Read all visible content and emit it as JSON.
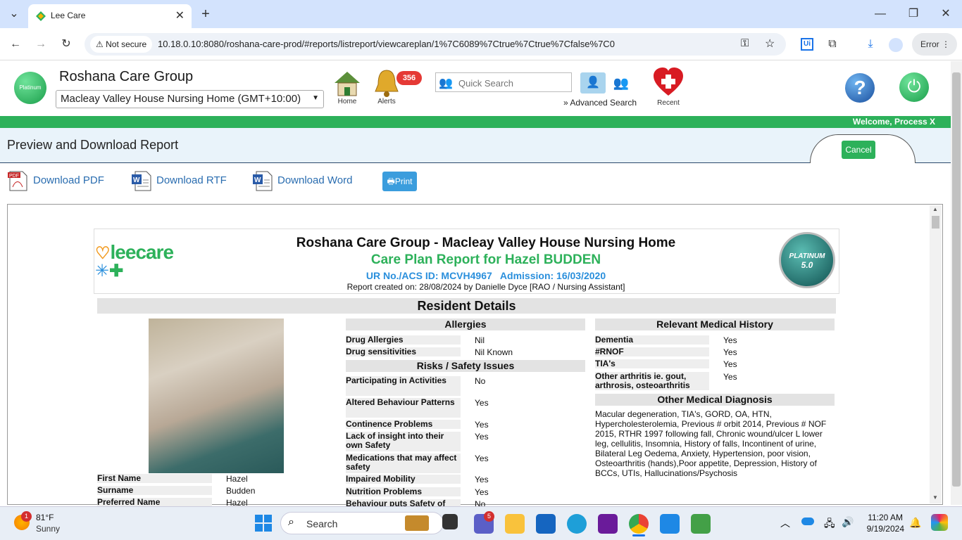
{
  "browser": {
    "tab_title": "Lee Care",
    "security_label": "Not secure",
    "url": "10.18.0.10:8080/roshana-care-prod/#reports/listreport/viewcareplan/1%7C6089%7Ctrue%7Ctrue%7Cfalse%7C0",
    "profile_label": "Error"
  },
  "app": {
    "org_name": "Roshana Care Group",
    "logo_text": "Platinum",
    "facility": "Macleay Valley House Nursing Home (GMT+10:00)",
    "nav": {
      "home": "Home",
      "alerts": "Alerts",
      "alerts_count": "356",
      "recent": "Recent"
    },
    "search_placeholder": "Quick Search",
    "advanced_search": "» Advanced Search",
    "welcome": "Welcome, Process X"
  },
  "preview": {
    "title": "Preview and Download Report",
    "cancel": "Cancel",
    "downloads": {
      "pdf": "Download PDF",
      "rtf": "Download RTF",
      "word": "Download Word",
      "print": "Print"
    }
  },
  "report": {
    "logo_text": "leecare",
    "heading": "Roshana Care Group - Macleay Valley House Nursing Home",
    "subheading": "Care Plan Report for Hazel BUDDEN",
    "ids": "UR No./ACS ID: MCVH4967   Admission: 16/03/2020",
    "created": "Report created on: 28/08/2024 by Danielle Dyce [RAO / Nursing Assistant]",
    "badge_line1": "PLATINUM",
    "badge_line2": "5.0",
    "section_title": "Resident Details",
    "allergies": {
      "title": "Allergies",
      "rows": [
        {
          "label": "Drug Allergies",
          "value": "Nil"
        },
        {
          "label": "Drug sensitivities",
          "value": "Nil Known"
        }
      ]
    },
    "risks": {
      "title": "Risks / Safety Issues",
      "rows": [
        {
          "label": "Participating in Activities",
          "value": "No"
        },
        {
          "label": "Altered Behaviour Patterns",
          "value": "Yes"
        },
        {
          "label": "Continence Problems",
          "value": "Yes"
        },
        {
          "label": "Lack of insight into their own Safety",
          "value": "Yes"
        },
        {
          "label": "Medications that may affect safety",
          "value": "Yes"
        },
        {
          "label": "Impaired Mobility",
          "value": "Yes"
        },
        {
          "label": "Nutrition Problems",
          "value": "Yes"
        },
        {
          "label": "Behaviour puts Safety of",
          "value": "No"
        }
      ]
    },
    "history": {
      "title": "Relevant Medical History",
      "rows": [
        {
          "label": "Dementia",
          "value": "Yes"
        },
        {
          "label": "#RNOF",
          "value": "Yes"
        },
        {
          "label": "TIA's",
          "value": "Yes"
        },
        {
          "label": "Other arthritis ie. gout, arthrosis, osteoarthritis",
          "value": "Yes"
        }
      ]
    },
    "diagnosis": {
      "title": "Other Medical Diagnosis",
      "text": "Macular degeneration, TIA's, GORD, OA, HTN, Hypercholesterolemia, Previous # orbit 2014, Previous # NOF 2015, RTHR 1997 following fall, Chronic wound/ulcer L lower leg, cellulitis, Insomnia, History of falls, Incontinent of urine, Bilateral Leg Oedema, Anxiety, Hypertension, poor vision, Osteoarthritis (hands),Poor appetite, Depression, History of BCCs, UTIs, Hallucinations/Psychosis"
    },
    "identity": [
      {
        "label": "First Name",
        "value": "Hazel"
      },
      {
        "label": "Surname",
        "value": "Budden"
      },
      {
        "label": "Preferred Name",
        "value": "Hazel"
      }
    ]
  },
  "taskbar": {
    "weather_temp": "81°F",
    "weather_desc": "Sunny",
    "weather_badge": "1",
    "search_label": "Search",
    "teams_badge": "5",
    "time": "11:20 AM",
    "date": "9/19/2024"
  }
}
